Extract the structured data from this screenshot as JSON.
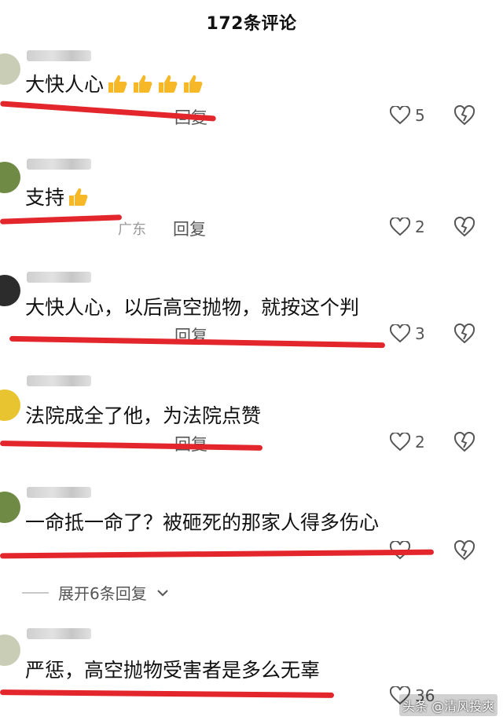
{
  "header": {
    "title": "172条评论"
  },
  "comments": [
    {
      "text": "大快人心",
      "thumbs": 4,
      "meta_text": "",
      "region": "",
      "reply_label": "回复",
      "likes": "5"
    },
    {
      "text": "支持",
      "thumbs": 1,
      "meta_text": "",
      "region": "广东",
      "reply_label": "回复",
      "likes": "2"
    },
    {
      "text": "大快人心，以后高空抛物，就按这个判",
      "thumbs": 0,
      "meta_text": "",
      "region": "",
      "reply_label": "回复",
      "likes": "3"
    },
    {
      "text": "法院成全了他，为法院点赞",
      "thumbs": 0,
      "meta_text": "",
      "region": "",
      "reply_label": "回复",
      "likes": "2"
    },
    {
      "text": "一命抵一命了？被砸死的那家人得多伤心",
      "thumbs": 0,
      "meta_text": "",
      "region": "",
      "reply_label": "",
      "likes": ""
    },
    {
      "text": "严惩，高空抛物受害者是多么无辜",
      "thumbs": 0,
      "meta_text": "",
      "region": "",
      "reply_label": "",
      "likes": "36"
    }
  ],
  "expand": {
    "label": "展开6条回复"
  },
  "watermark": "头条 @清风投爽",
  "colors": {
    "redline": "#e3262c",
    "thumb": "#f6b826"
  }
}
